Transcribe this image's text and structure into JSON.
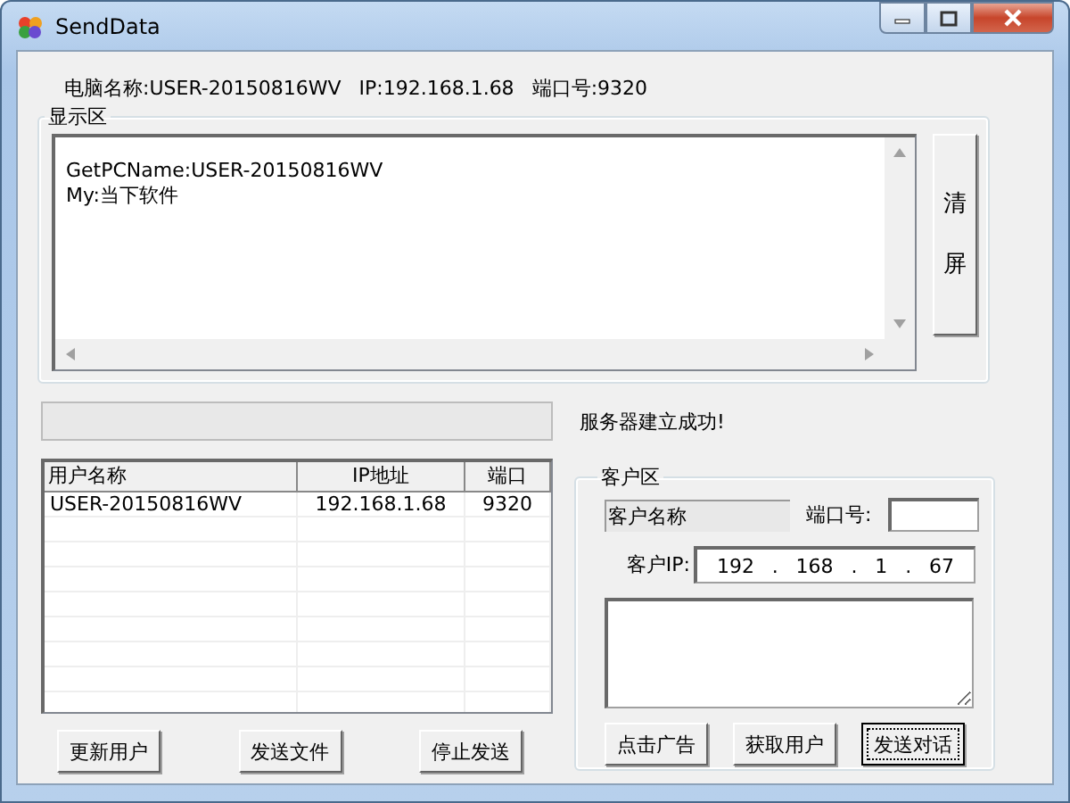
{
  "window": {
    "title": "SendData"
  },
  "info": [
    "电脑名称:USER-20150816WV",
    "IP:192.168.1.68",
    "端口号:9320"
  ],
  "display": {
    "legend": "显示区",
    "lines": [
      "GetPCName:USER-20150816WV",
      "My:当下软件"
    ],
    "clear_button": "清屏"
  },
  "progress": {
    "level": 0
  },
  "status": "服务器建立成功!",
  "user_table": {
    "columns": [
      "用户名称",
      "IP地址",
      "端口"
    ],
    "rows": [
      [
        "USER-20150816WV",
        "192.168.1.68",
        "9320"
      ]
    ]
  },
  "buttons": [
    "更新用户",
    "发送文件",
    "停止发送"
  ],
  "client": {
    "legend": "客户区",
    "name_field": "客户名称",
    "port_label": "端口号:",
    "ip_label": "客户IP:",
    "ip_parts": [
      "192",
      ".",
      "168",
      ".",
      "1",
      ".",
      "67"
    ],
    "buttons": [
      {
        "label": "点击广告",
        "focused": false
      },
      {
        "label": "获取用户",
        "focused": false
      },
      {
        "label": "发送对话",
        "focused": true
      }
    ]
  }
}
